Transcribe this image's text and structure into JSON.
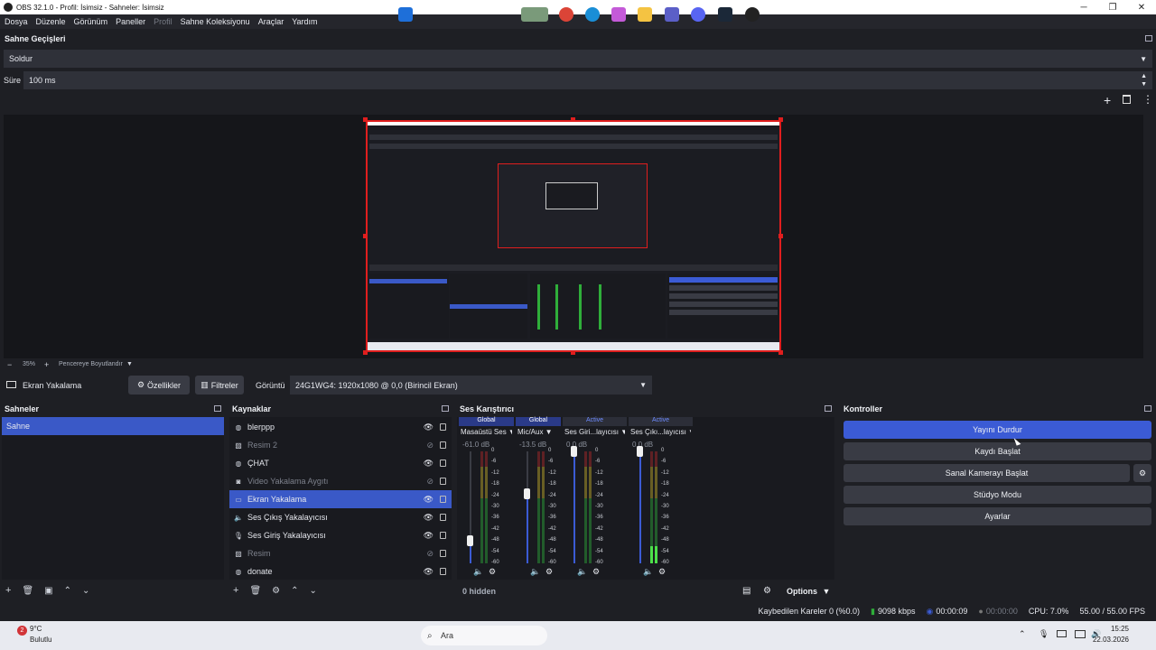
{
  "window": {
    "title": "OBS 32.1.0 - Profil: İsimsiz - Sahneler: İsimsiz",
    "controls": {
      "minimize": "─",
      "maximize": "❐",
      "close": "✕"
    }
  },
  "menu": {
    "items": [
      "Dosya",
      "Düzenle",
      "Görünüm",
      "Paneller",
      "Profil",
      "Sahne Koleksiyonu",
      "Araçlar",
      "Yardım"
    ]
  },
  "transitions": {
    "title": "Sahne Geçişleri",
    "selected": "Soldur",
    "duration_label": "Süre",
    "duration_value": "100 ms"
  },
  "preview": {
    "zoom": "35%",
    "zoom_mode": "Pencereye Boyutlandır"
  },
  "source_toolbar": {
    "source_name": "Ekran Yakalama",
    "properties": "Özellikler",
    "filters": "Filtreler",
    "display_label": "Görüntü",
    "display_value": "24G1WG4: 1920x1080 @ 0,0 (Birincil Ekran)"
  },
  "scenes": {
    "title": "Sahneler",
    "items": [
      {
        "label": "Sahne",
        "selected": true
      }
    ]
  },
  "sources": {
    "title": "Kaynaklar",
    "items": [
      {
        "label": "blerppp",
        "icon": "globe-icon",
        "visible": true,
        "dim": false
      },
      {
        "label": "Resim 2",
        "icon": "image-icon",
        "visible": false,
        "dim": true
      },
      {
        "label": "ÇHAT",
        "icon": "globe-icon",
        "visible": true,
        "dim": false
      },
      {
        "label": "Video Yakalama Aygıtı",
        "icon": "camera-icon",
        "visible": false,
        "dim": true
      },
      {
        "label": "Ekran Yakalama",
        "icon": "monitor-icon",
        "visible": true,
        "dim": false,
        "selected": true
      },
      {
        "label": "Ses Çıkış Yakalayıcısı",
        "icon": "speaker-icon",
        "visible": true,
        "dim": false
      },
      {
        "label": "Ses Giriş Yakalayıcısı",
        "icon": "mic-icon",
        "visible": true,
        "dim": false
      },
      {
        "label": "Resim",
        "icon": "image-icon",
        "visible": false,
        "dim": true
      },
      {
        "label": "donate",
        "icon": "globe-icon",
        "visible": true,
        "dim": false
      }
    ]
  },
  "mixer": {
    "title": "Ses Karıştırıcı",
    "hidden_label": "0 hidden",
    "options_label": "Options",
    "scale": [
      "0",
      "-6",
      "-12",
      "-18",
      "-24",
      "-30",
      "-36",
      "-42",
      "-48",
      "-54",
      "-60"
    ],
    "channels": [
      {
        "badge": "Global",
        "badge_type": "global",
        "name": "Masaüstü Ses",
        "db": "-61.0 dB",
        "fader": 0.2,
        "level": 0.0
      },
      {
        "badge": "Global",
        "badge_type": "global",
        "name": "Mic/Aux",
        "db": "-13.5 dB",
        "fader": 0.62,
        "level": 0.0
      },
      {
        "badge": "Active",
        "badge_type": "active",
        "name": "Ses Giri...layıcısı",
        "db": "0.0 dB",
        "fader": 1.0,
        "level": 0.0
      },
      {
        "badge": "Active",
        "badge_type": "active",
        "name": "Ses Çıkı...layıcısı",
        "db": "0.0 dB",
        "fader": 1.0,
        "level": 0.15
      }
    ]
  },
  "controls": {
    "title": "Kontroller",
    "stop_stream": "Yayını Durdur",
    "start_record": "Kaydı Başlat",
    "start_virtualcam": "Sanal Kamerayı Başlat",
    "studio_mode": "Stüdyo Modu",
    "settings": "Ayarlar"
  },
  "status": {
    "dropped_frames": "Kaybedilen Kareler 0 (%0.0)",
    "bitrate": "9098 kbps",
    "stream_time": "00:00:09",
    "record_time": "00:00:00",
    "cpu": "CPU: 7.0%",
    "fps": "55.00 / 55.00 FPS"
  },
  "taskbar": {
    "weather_temp": "9°C",
    "weather_desc": "Bulutlu",
    "notification_count": "2",
    "search_placeholder": "Ara",
    "time": "15:25",
    "date": "22.03.2026"
  },
  "colors": {
    "accent": "#3b5bd5",
    "selection_border": "#e01e1e",
    "meter_green": "#2fae3a",
    "meter_yellow": "#c9b22b",
    "meter_red": "#b42a2a"
  }
}
